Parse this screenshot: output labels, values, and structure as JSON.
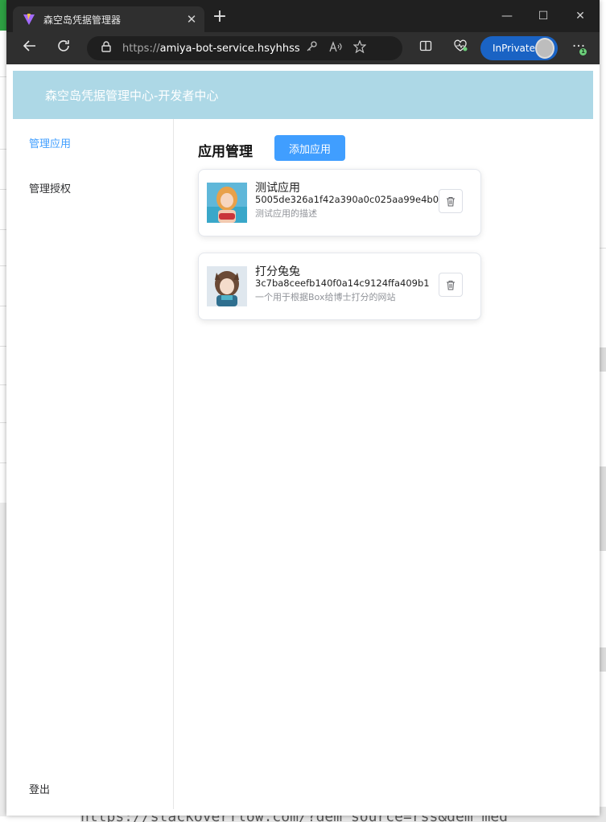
{
  "browser": {
    "tab_title": "森空岛凭据管理器",
    "tab_close": "✕",
    "new_tab": "+",
    "minimize": "—",
    "maximize": "☐",
    "close": "✕",
    "url_scheme": "https://",
    "url_host": "amiya-bot-service.hsyhhss...",
    "inprivate_label": "InPrivate",
    "notification_count": "1"
  },
  "app": {
    "header_title": "森空岛凭据管理中心-开发者中心",
    "nav": [
      {
        "label": "管理应用",
        "active": true
      },
      {
        "label": "管理授权",
        "active": false
      }
    ],
    "logout_label": "登出",
    "page_heading": "应用管理",
    "add_button_label": "添加应用",
    "apps": [
      {
        "name": "测试应用",
        "id": "5005de326a1f42a390a0c025aa99e4b0",
        "description": "测试应用的描述"
      },
      {
        "name": "打分兔兔",
        "id": "3c7ba8ceefb140f0a14c9124ffa409b1",
        "description": "一个用于根据Box给博士打分的网站"
      }
    ]
  },
  "background_page": {
    "url_fragment": "https://stackoverflow.com/?dem_source=rss&dem_med"
  },
  "colors": {
    "header_bg": "#add8e6",
    "primary": "#409eff",
    "inprivate": "#1a63c4"
  }
}
